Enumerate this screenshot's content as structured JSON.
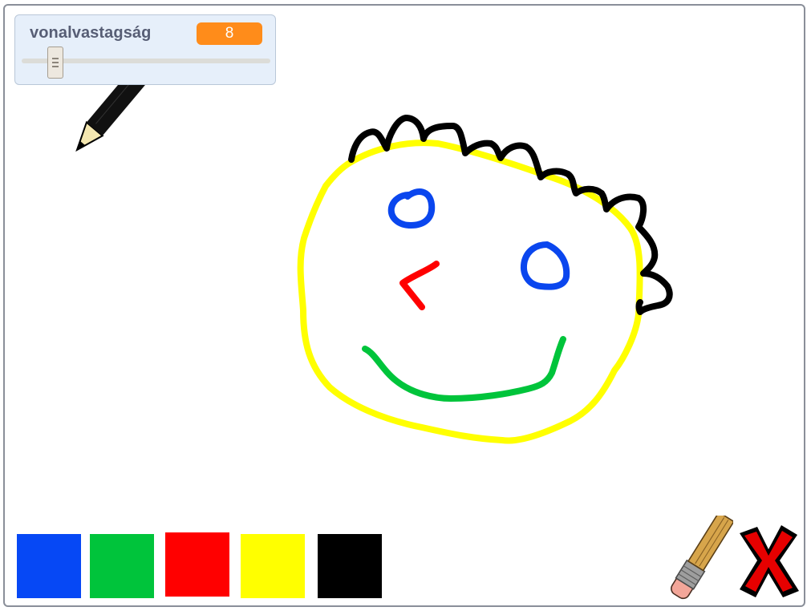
{
  "variable_monitor": {
    "label": "vonalvastagság",
    "value": "8",
    "slider": {
      "min": 1,
      "max": 20,
      "value": 8
    }
  },
  "palette": {
    "swatches": [
      {
        "name": "blue",
        "color": "#0648f5"
      },
      {
        "name": "green",
        "color": "#00c43b"
      },
      {
        "name": "red",
        "color": "#ff0000"
      },
      {
        "name": "yellow",
        "color": "#ffff00"
      },
      {
        "name": "black",
        "color": "#000000"
      }
    ]
  },
  "tools": {
    "pencil_icon": "pencil-icon",
    "eraser_icon": "eraser-icon",
    "clear_icon": "red-x-icon"
  },
  "drawing": {
    "colors": {
      "face": "#ffff00",
      "hair": "#000000",
      "eyes": "#0a46ee",
      "nose": "#ff0000",
      "mouth": "#00c43b"
    }
  }
}
